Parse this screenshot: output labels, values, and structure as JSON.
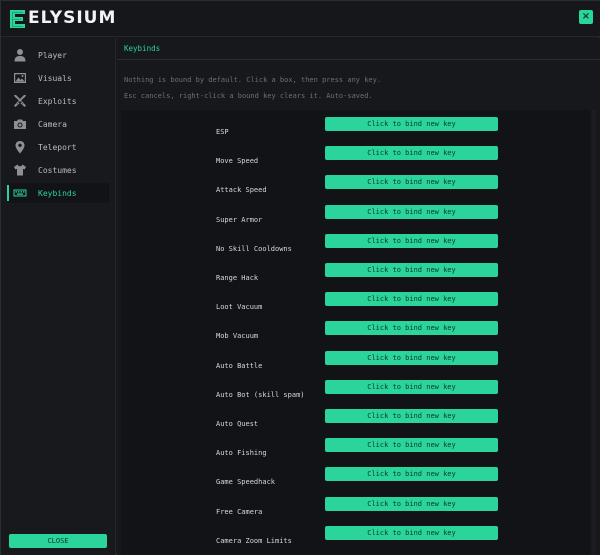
{
  "app": {
    "title": "ELYSIUM",
    "brand_color": "#2ad49a",
    "close_glyph": "×"
  },
  "sidebar": {
    "items": [
      {
        "label": "Player",
        "icon": "person-icon"
      },
      {
        "label": "Visuals",
        "icon": "image-icon"
      },
      {
        "label": "Exploits",
        "icon": "crossed-swords-icon"
      },
      {
        "label": "Camera",
        "icon": "camera-icon"
      },
      {
        "label": "Teleport",
        "icon": "map-pin-icon"
      },
      {
        "label": "Costumes",
        "icon": "shirt-icon"
      },
      {
        "label": "Keybinds",
        "icon": "keyboard-icon",
        "active": true
      }
    ],
    "close_label": "CLOSE"
  },
  "main": {
    "section_title": "Keybinds",
    "help_line_1": "Nothing is bound by default. Click a box, then press any key.",
    "help_line_2": "Esc cancels, right-click a bound key clears it. Auto-saved.",
    "bind_button_label": "Click to bind new key",
    "keybinds": [
      {
        "label": "ESP"
      },
      {
        "label": "Move Speed"
      },
      {
        "label": "Attack Speed"
      },
      {
        "label": "Super Armor"
      },
      {
        "label": "No Skill Cooldowns"
      },
      {
        "label": "Range Hack"
      },
      {
        "label": "Loot Vacuum"
      },
      {
        "label": "Mob Vacuum"
      },
      {
        "label": "Auto Battle"
      },
      {
        "label": "Auto Bot (skill spam)"
      },
      {
        "label": "Auto Quest"
      },
      {
        "label": "Auto Fishing"
      },
      {
        "label": "Game Speedhack"
      },
      {
        "label": "Free Camera"
      },
      {
        "label": "Camera Zoom Limits"
      }
    ]
  }
}
